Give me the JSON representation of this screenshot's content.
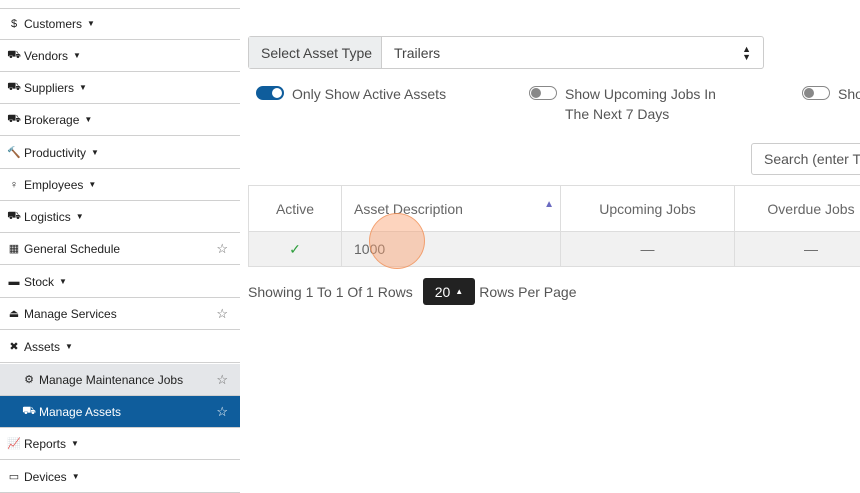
{
  "sidebar": {
    "items": [
      {
        "label": "Customers",
        "icon": "$"
      },
      {
        "label": "Vendors",
        "icon": "⛟"
      },
      {
        "label": "Suppliers",
        "icon": "⛟"
      },
      {
        "label": "Brokerage",
        "icon": "⛟"
      },
      {
        "label": "Productivity",
        "icon": "🔨"
      },
      {
        "label": "Employees",
        "icon": "♀"
      },
      {
        "label": "Logistics",
        "icon": "⛟"
      },
      {
        "label": "General Schedule",
        "icon": "▦"
      },
      {
        "label": "Stock",
        "icon": "▬"
      },
      {
        "label": "Manage Services",
        "icon": "⏏"
      },
      {
        "label": "Assets",
        "icon": "✖"
      },
      {
        "label": "Manage Maintenance Jobs",
        "icon": "⚙"
      },
      {
        "label": "Manage Assets",
        "icon": "⛟"
      },
      {
        "label": "Reports",
        "icon": "📈"
      },
      {
        "label": "Devices",
        "icon": "▭"
      }
    ]
  },
  "asset_type": {
    "label": "Select Asset Type",
    "value": "Trailers"
  },
  "toggles": [
    {
      "label": "Only Show Active Assets",
      "on": true
    },
    {
      "label": "Show Upcoming Jobs In The Next 7 Days",
      "on": false
    },
    {
      "label": "Sho",
      "on": false
    }
  ],
  "search": {
    "placeholder": "Search (enter To"
  },
  "table": {
    "headers": [
      "Active",
      "Asset Description",
      "Upcoming Jobs",
      "Overdue Jobs"
    ],
    "rows": [
      {
        "active": "✓",
        "description": "1000",
        "upcoming": "—",
        "overdue": "—"
      }
    ]
  },
  "footer": {
    "showing": "Showing 1 To 1 Of 1 Rows",
    "rows_per_page_value": "20",
    "rows_per_page_label": "Rows Per Page"
  },
  "colors": {
    "accent": "#0f5d9c",
    "check": "#2e9e3d"
  }
}
